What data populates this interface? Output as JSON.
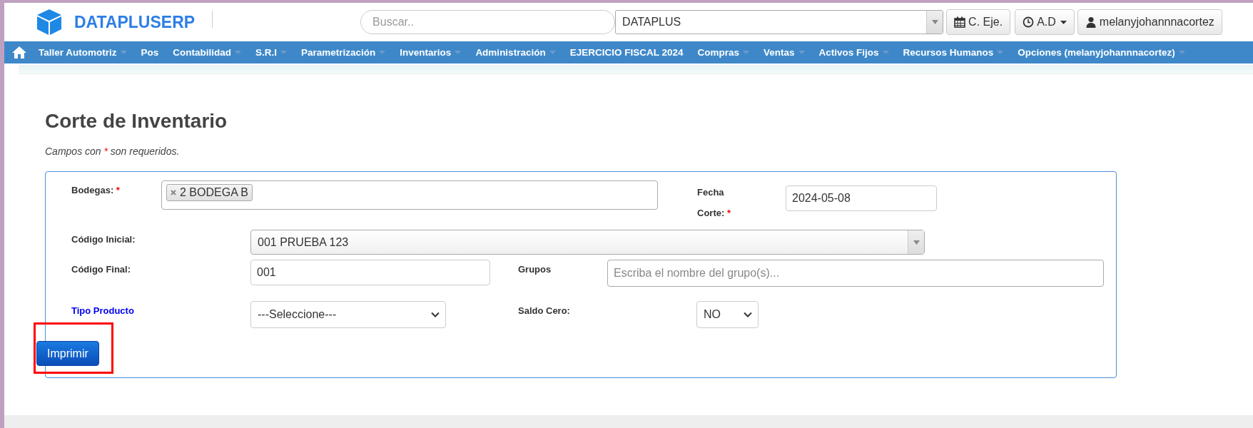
{
  "header": {
    "brand": "DATAPLUSERP",
    "search": {
      "placeholder": "Buscar.."
    },
    "company": {
      "value": "DATAPLUS"
    },
    "buttons": [
      {
        "kind": "calendar",
        "label": "C. Eje.",
        "caret": false
      },
      {
        "kind": "clock",
        "label": "A.D",
        "caret": true
      },
      {
        "kind": "user",
        "label": "melanyjohannnacortez",
        "caret": false
      }
    ]
  },
  "nav": [
    {
      "label": "Taller Automotriz",
      "caret": true
    },
    {
      "label": "Pos",
      "caret": false
    },
    {
      "label": "Contabilidad",
      "caret": true
    },
    {
      "label": "S.R.I",
      "caret": true
    },
    {
      "label": "Parametrización",
      "caret": true
    },
    {
      "label": "Inventarios",
      "caret": true
    },
    {
      "label": "Administración",
      "caret": true
    },
    {
      "label": "EJERCICIO FISCAL 2024",
      "caret": false
    },
    {
      "label": "Compras",
      "caret": true
    },
    {
      "label": "Ventas",
      "caret": true
    },
    {
      "label": "Activos Fijos",
      "caret": true
    },
    {
      "label": "Recursos Humanos",
      "caret": true
    },
    {
      "label": "Opciones (melanyjohannnacortez)",
      "caret": true
    }
  ],
  "page": {
    "title": "Corte de Inventario",
    "note": {
      "before": "Campos con",
      "mark": "*",
      "after": "son requeridos."
    }
  },
  "form": {
    "rows": [
      [
        {
          "label": "Bodegas:",
          "required": true,
          "kind": "tags",
          "tags": [
            "2 BODEGA B"
          ]
        },
        {
          "label": "Fecha Corte:",
          "required": true,
          "kind": "text",
          "value": "2024-05-08"
        }
      ],
      [
        {
          "label": "Código Inicial:",
          "required": false,
          "kind": "combo",
          "value": "001 PRUEBA 123"
        }
      ],
      [
        {
          "label": "Código Final:",
          "required": false,
          "kind": "text",
          "value": "001"
        },
        {
          "label": "Grupos",
          "required": false,
          "kind": "text",
          "placeholder": "Escriba el nombre del grupo(s)..."
        }
      ],
      [
        {
          "label": "Tipo Producto",
          "required": false,
          "kind": "select",
          "link": true,
          "value": "---Seleccione---"
        },
        {
          "label": "Saldo Cero:",
          "required": false,
          "kind": "select",
          "value": "NO"
        }
      ]
    ],
    "submit": {
      "label": "Imprimir",
      "highlighted": true
    }
  }
}
